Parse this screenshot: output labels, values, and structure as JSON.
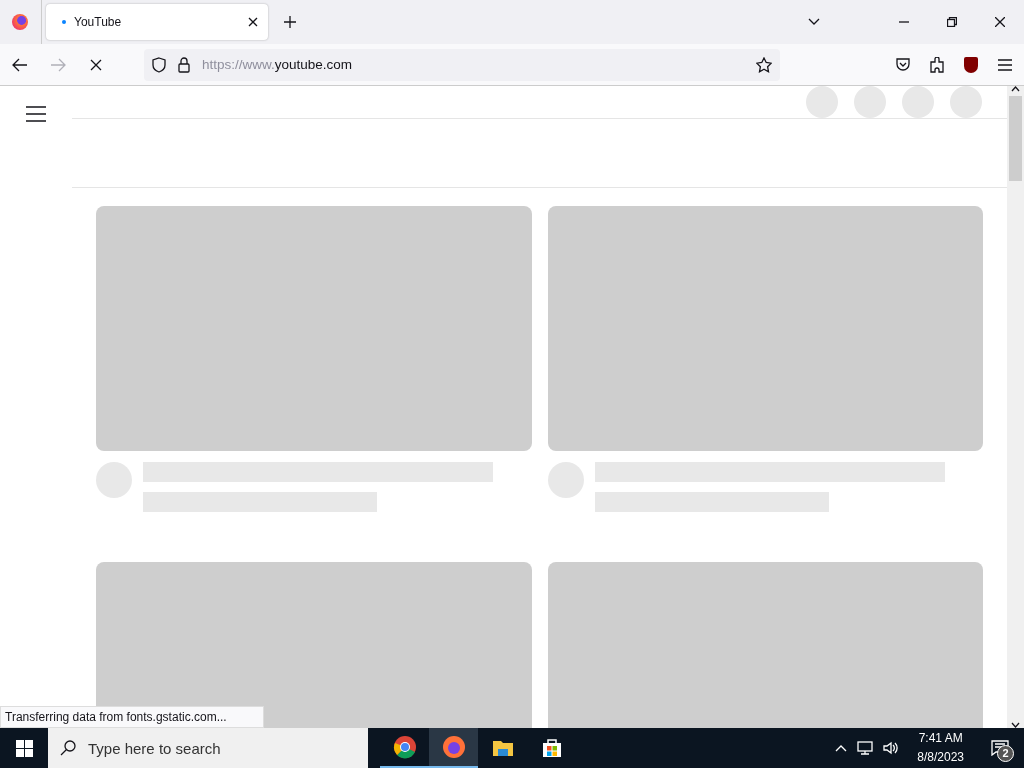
{
  "browser": {
    "tabs": [
      {
        "title": "YouTube",
        "loading": true,
        "selected": true
      }
    ],
    "loading": true,
    "url": {
      "prefix": "https://www.",
      "domain": "youtube.com"
    },
    "status": "Transferring data from fonts.gstatic.com..."
  },
  "taskbar": {
    "search": {
      "placeholder": "Type here to search"
    },
    "apps": [
      {
        "kind": "chrome",
        "running": true,
        "selected": false
      },
      {
        "kind": "firefox",
        "running": true,
        "selected": true
      },
      {
        "kind": "explorer",
        "running": false,
        "selected": false
      },
      {
        "kind": "store",
        "running": false,
        "selected": false
      }
    ],
    "time": "7:41 AM",
    "date": "8/8/2023",
    "notifications": "2"
  }
}
